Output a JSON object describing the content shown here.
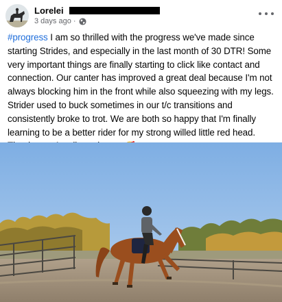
{
  "post": {
    "author": "Lorelei",
    "timestamp": "3 days ago",
    "separator": "·",
    "privacy_icon": "globe-icon",
    "more_icon": "more-options-icon",
    "hashtag": "#progress",
    "body": " I am so thrilled with the progress we've made since starting Strides, and especially in the last month of 30 DTR! Some very important things are finally starting to click like contact and connection. Our canter has improved a great deal because I'm not always blocking him in the front while also squeezing with my legs. Strider used to buck sometimes in our t/c transitions and consistently broke to trot. We are both so happy that I'm finally learning to be a better rider for my strong willed little red head. Thank you, Amelia and team.",
    "emoji": "🥰"
  },
  "colors": {
    "hashtag": "#216fdb",
    "secondary_text": "#65676b"
  }
}
